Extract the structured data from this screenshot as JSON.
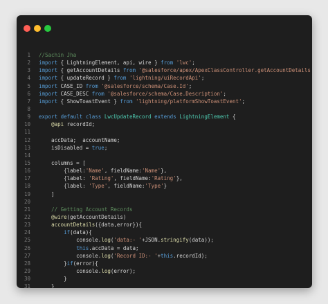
{
  "window": {
    "controls": [
      "close",
      "minimize",
      "zoom"
    ]
  },
  "lines": [
    {
      "n": "1",
      "tokens": [
        {
          "t": "//Sachin Jha",
          "c": "comment"
        }
      ]
    },
    {
      "n": "2",
      "tokens": [
        {
          "t": "import",
          "c": "kw"
        },
        {
          "t": " { LightningElement, api, wire } ",
          "c": "plain"
        },
        {
          "t": "from",
          "c": "kw"
        },
        {
          "t": " ",
          "c": "plain"
        },
        {
          "t": "'lwc'",
          "c": "str"
        },
        {
          "t": ";",
          "c": "plain"
        }
      ]
    },
    {
      "n": "3",
      "tokens": [
        {
          "t": "import",
          "c": "kw"
        },
        {
          "t": " { getAccountDetails ",
          "c": "plain"
        },
        {
          "t": "from",
          "c": "kw"
        },
        {
          "t": " ",
          "c": "plain"
        },
        {
          "t": "'@salesforce/apex/ApexClassController.getAccountDetails'",
          "c": "str"
        }
      ]
    },
    {
      "n": "4",
      "tokens": [
        {
          "t": "import",
          "c": "kw"
        },
        {
          "t": " { updateRecord } ",
          "c": "plain"
        },
        {
          "t": "from",
          "c": "kw"
        },
        {
          "t": " ",
          "c": "plain"
        },
        {
          "t": "'lightning/uiRecordApi'",
          "c": "str"
        },
        {
          "t": ";",
          "c": "plain"
        }
      ]
    },
    {
      "n": "5",
      "tokens": [
        {
          "t": "import",
          "c": "kw"
        },
        {
          "t": " CASE_ID ",
          "c": "plain"
        },
        {
          "t": "from",
          "c": "kw"
        },
        {
          "t": " ",
          "c": "plain"
        },
        {
          "t": "'@salesforce/schema/Case.Id'",
          "c": "str"
        },
        {
          "t": ";",
          "c": "plain"
        }
      ]
    },
    {
      "n": "6",
      "tokens": [
        {
          "t": "import",
          "c": "kw"
        },
        {
          "t": " CASE_DESC ",
          "c": "plain"
        },
        {
          "t": "from",
          "c": "kw"
        },
        {
          "t": " ",
          "c": "plain"
        },
        {
          "t": "'@salesforce/schema/Case.Description'",
          "c": "str"
        },
        {
          "t": ";",
          "c": "plain"
        }
      ]
    },
    {
      "n": "7",
      "tokens": [
        {
          "t": "import",
          "c": "kw"
        },
        {
          "t": " { ShowToastEvent } ",
          "c": "plain"
        },
        {
          "t": "from",
          "c": "kw"
        },
        {
          "t": " ",
          "c": "plain"
        },
        {
          "t": "'lightning/platformShowToastEvent'",
          "c": "str"
        },
        {
          "t": ";",
          "c": "plain"
        }
      ]
    },
    {
      "n": "8",
      "tokens": []
    },
    {
      "n": "9",
      "tokens": [
        {
          "t": "export default class",
          "c": "kw"
        },
        {
          "t": " ",
          "c": "plain"
        },
        {
          "t": "LwcUpdateRecord",
          "c": "cls"
        },
        {
          "t": " ",
          "c": "plain"
        },
        {
          "t": "extends",
          "c": "kw"
        },
        {
          "t": " ",
          "c": "plain"
        },
        {
          "t": "LightningElement",
          "c": "cls"
        },
        {
          "t": " {",
          "c": "plain"
        }
      ]
    },
    {
      "n": "10",
      "tokens": [
        {
          "t": "    ",
          "c": "plain"
        },
        {
          "t": "@api",
          "c": "dec"
        },
        {
          "t": " recordId;",
          "c": "plain"
        }
      ]
    },
    {
      "n": "11",
      "tokens": []
    },
    {
      "n": "12",
      "tokens": [
        {
          "t": "    accData;  accountName;",
          "c": "plain"
        }
      ]
    },
    {
      "n": "13",
      "tokens": [
        {
          "t": "    isDisabled = ",
          "c": "plain"
        },
        {
          "t": "true",
          "c": "kw"
        },
        {
          "t": ";",
          "c": "plain"
        }
      ]
    },
    {
      "n": "14",
      "tokens": []
    },
    {
      "n": "15",
      "tokens": [
        {
          "t": "    columns = [",
          "c": "plain"
        }
      ]
    },
    {
      "n": "16",
      "tokens": [
        {
          "t": "        {label:",
          "c": "plain"
        },
        {
          "t": "'Name'",
          "c": "str"
        },
        {
          "t": ", fieldName:",
          "c": "plain"
        },
        {
          "t": "'Name'",
          "c": "str"
        },
        {
          "t": "},",
          "c": "plain"
        }
      ]
    },
    {
      "n": "17",
      "tokens": [
        {
          "t": "        {label: ",
          "c": "plain"
        },
        {
          "t": "'Rating'",
          "c": "str"
        },
        {
          "t": ", fieldName:",
          "c": "plain"
        },
        {
          "t": "'Rating'",
          "c": "str"
        },
        {
          "t": "},",
          "c": "plain"
        }
      ]
    },
    {
      "n": "18",
      "tokens": [
        {
          "t": "        {label: ",
          "c": "plain"
        },
        {
          "t": "'Type'",
          "c": "str"
        },
        {
          "t": ", fieldName:",
          "c": "plain"
        },
        {
          "t": "'Type'",
          "c": "str"
        },
        {
          "t": "}",
          "c": "plain"
        }
      ]
    },
    {
      "n": "19",
      "tokens": [
        {
          "t": "    ]",
          "c": "plain"
        }
      ]
    },
    {
      "n": "20",
      "tokens": []
    },
    {
      "n": "21",
      "tokens": [
        {
          "t": "    ",
          "c": "plain"
        },
        {
          "t": "// Getting Account Records",
          "c": "comment"
        }
      ]
    },
    {
      "n": "22",
      "tokens": [
        {
          "t": "    ",
          "c": "plain"
        },
        {
          "t": "@wire",
          "c": "dec"
        },
        {
          "t": "(getAccountDetails)",
          "c": "plain"
        }
      ]
    },
    {
      "n": "23",
      "tokens": [
        {
          "t": "    ",
          "c": "plain"
        },
        {
          "t": "accountDetails",
          "c": "fn"
        },
        {
          "t": "({data,error}){",
          "c": "plain"
        }
      ]
    },
    {
      "n": "24",
      "tokens": [
        {
          "t": "        ",
          "c": "plain"
        },
        {
          "t": "if",
          "c": "kw"
        },
        {
          "t": "(data){",
          "c": "plain"
        }
      ]
    },
    {
      "n": "25",
      "tokens": [
        {
          "t": "            console.",
          "c": "plain"
        },
        {
          "t": "log",
          "c": "fn"
        },
        {
          "t": "(",
          "c": "plain"
        },
        {
          "t": "'data:- '",
          "c": "str"
        },
        {
          "t": "+JSON.",
          "c": "plain"
        },
        {
          "t": "stringify",
          "c": "fn"
        },
        {
          "t": "(data));",
          "c": "plain"
        }
      ]
    },
    {
      "n": "26",
      "tokens": [
        {
          "t": "            ",
          "c": "plain"
        },
        {
          "t": "this",
          "c": "kw"
        },
        {
          "t": ".accData = data;",
          "c": "plain"
        }
      ]
    },
    {
      "n": "27",
      "tokens": [
        {
          "t": "            console.",
          "c": "plain"
        },
        {
          "t": "log",
          "c": "fn"
        },
        {
          "t": "(",
          "c": "plain"
        },
        {
          "t": "'Record ID:- '",
          "c": "str"
        },
        {
          "t": "+",
          "c": "plain"
        },
        {
          "t": "this",
          "c": "kw"
        },
        {
          "t": ".recordId);",
          "c": "plain"
        }
      ]
    },
    {
      "n": "28",
      "tokens": [
        {
          "t": "        }",
          "c": "plain"
        },
        {
          "t": "if",
          "c": "kw"
        },
        {
          "t": "(error){",
          "c": "plain"
        }
      ]
    },
    {
      "n": "29",
      "tokens": [
        {
          "t": "            console.",
          "c": "plain"
        },
        {
          "t": "log",
          "c": "fn"
        },
        {
          "t": "(error);",
          "c": "plain"
        }
      ]
    },
    {
      "n": "30",
      "tokens": [
        {
          "t": "        }",
          "c": "plain"
        }
      ]
    },
    {
      "n": "31",
      "tokens": [
        {
          "t": "    }",
          "c": "plain"
        }
      ]
    },
    {
      "n": "32",
      "tokens": []
    }
  ]
}
